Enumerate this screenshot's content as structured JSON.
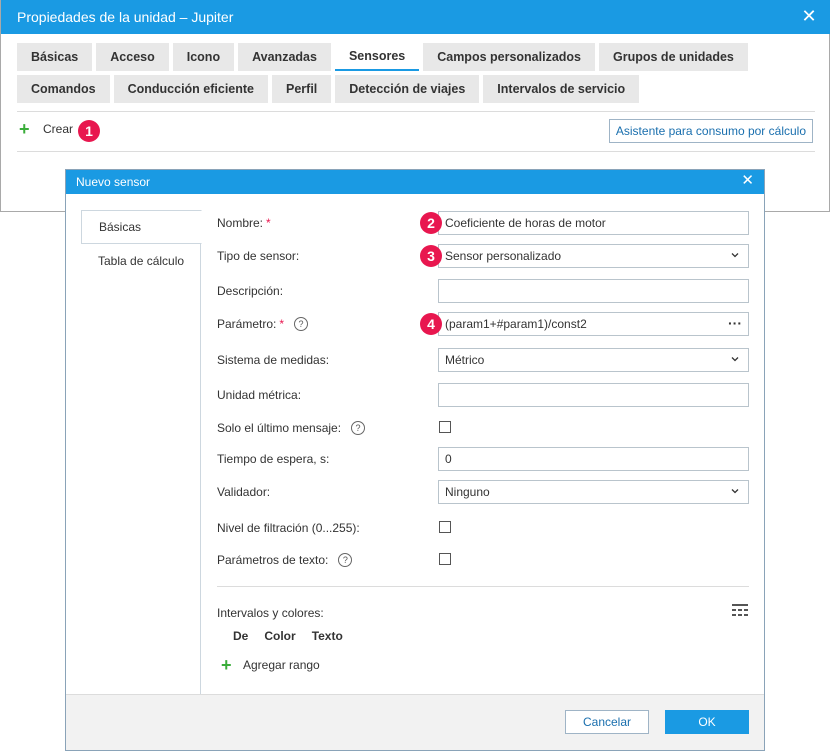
{
  "window": {
    "title": "Propiedades de la unidad – Jupiter",
    "close_glyph": "✕",
    "tabs_row1": [
      "Básicas",
      "Acceso",
      "Icono",
      "Avanzadas",
      "Sensores",
      "Campos personalizados",
      "Grupos de unidades"
    ],
    "tabs_row2": [
      "Comandos",
      "Conducción eficiente",
      "Perfil",
      "Detección de viajes",
      "Intervalos de servicio"
    ],
    "active_tab": "Sensores",
    "create_label": "Crear",
    "wizard_label": "Asistente para consumo por cálculo",
    "badge1": "1"
  },
  "dialog": {
    "title": "Nuevo sensor",
    "close_glyph": "✕",
    "side_nav": [
      "Básicas",
      "Tabla de cálculo"
    ],
    "fields": {
      "name_label": "Nombre:",
      "name_value": "Coeficiente de horas de motor",
      "type_label": "Tipo de sensor:",
      "type_value": "Sensor personalizado",
      "desc_label": "Descripción:",
      "desc_value": "",
      "param_label": "Parámetro:",
      "param_value": "(param1+#param1)/const2",
      "units_label": "Sistema de medidas:",
      "units_value": "Métrico",
      "metric_label": "Unidad métrica:",
      "metric_value": "",
      "last_msg_label": "Solo el último mensaje:",
      "timeout_label": "Tiempo de espera, s:",
      "timeout_value": "0",
      "validator_label": "Validador:",
      "validator_value": "Ninguno",
      "filter_label": "Nivel de filtración (0...255):",
      "text_params_label": "Parámetros de texto:"
    },
    "required_mark": "*",
    "help_glyph": "?",
    "ranges_label": "Intervalos y colores:",
    "ranges_columns": [
      "De",
      "Color",
      "Texto"
    ],
    "add_range_label": "Agregar rango",
    "cancel_label": "Cancelar",
    "ok_label": "OK",
    "badges": [
      "2",
      "3",
      "4"
    ]
  },
  "colors": {
    "accent": "#1a9ae3",
    "badge": "#e8174f",
    "plus": "#3aad3a"
  },
  "icons": {
    "select_arrow": "chevron-down-icon",
    "more": "ellipsis-icon",
    "ranges": "table-settings-icon"
  }
}
